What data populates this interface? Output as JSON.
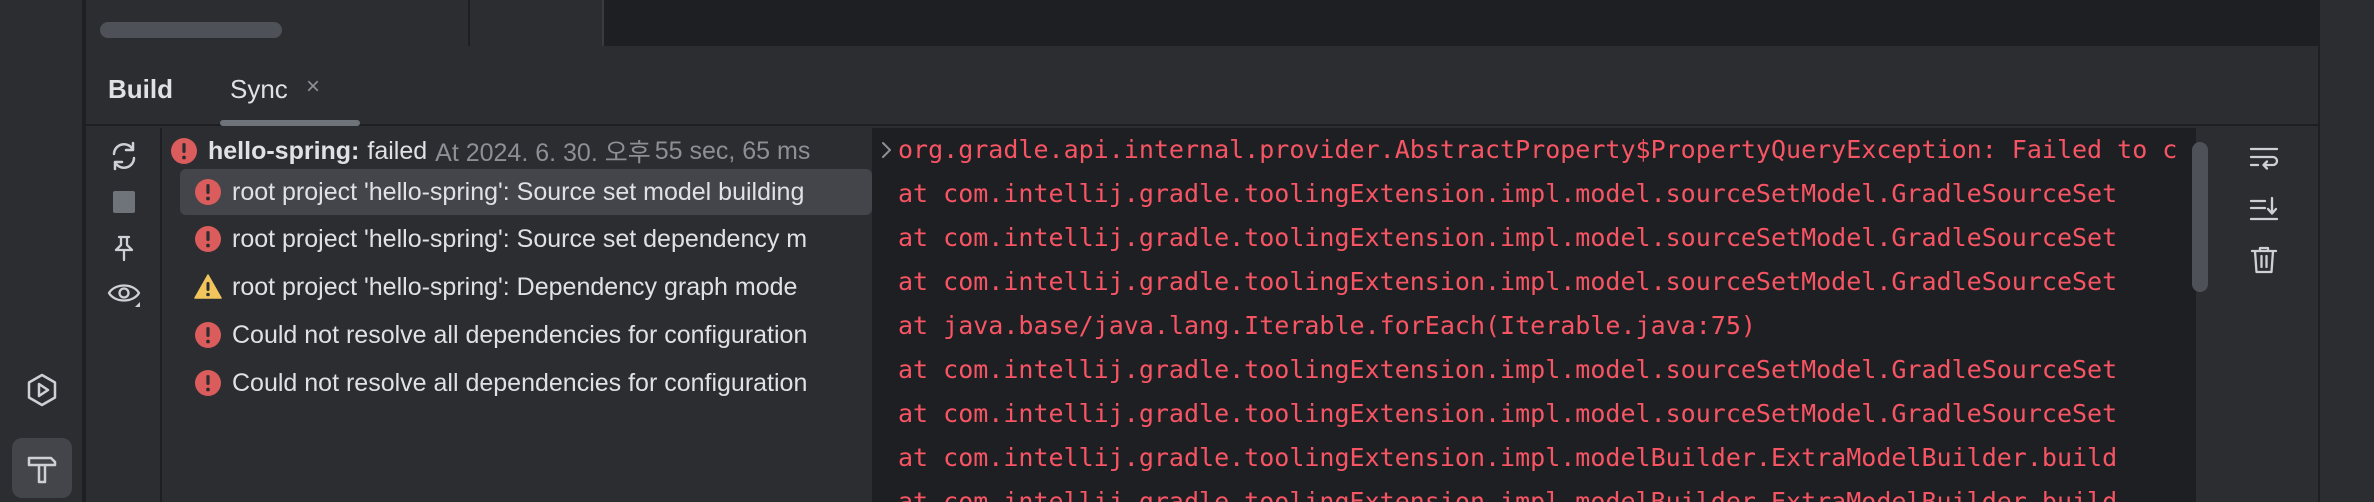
{
  "tool_window": {
    "title": "Build",
    "tabs": [
      {
        "label": "Sync",
        "close": "×"
      }
    ]
  },
  "toolbar": {
    "buttons": [
      "sync-icon",
      "stop-icon",
      "pin-icon",
      "eye-icon"
    ]
  },
  "tree": {
    "root": {
      "name": "hello-spring:",
      "status": "failed",
      "time": "At 2024. 6. 30. 오후",
      "duration": "55 sec, 65 ms"
    },
    "items": [
      {
        "icon": "error-icon",
        "text": "root project 'hello-spring': Source set model building"
      },
      {
        "icon": "error-icon",
        "text": "root project 'hello-spring': Source set dependency m"
      },
      {
        "icon": "warning-icon",
        "text": "root project 'hello-spring': Dependency graph mode"
      },
      {
        "icon": "error-icon",
        "text": "Could not resolve all dependencies for configuration"
      },
      {
        "icon": "error-icon",
        "text": "Could not resolve all dependencies for configuration"
      }
    ]
  },
  "console": {
    "lines": [
      "org.gradle.api.internal.provider.AbstractProperty$PropertyQueryException: Failed to c",
      "    at com.intellij.gradle.toolingExtension.impl.model.sourceSetModel.GradleSourceSet",
      "    at com.intellij.gradle.toolingExtension.impl.model.sourceSetModel.GradleSourceSet",
      "    at com.intellij.gradle.toolingExtension.impl.model.sourceSetModel.GradleSourceSet",
      "    at java.base/java.lang.Iterable.forEach(Iterable.java:75)",
      "    at com.intellij.gradle.toolingExtension.impl.model.sourceSetModel.GradleSourceSet",
      "    at com.intellij.gradle.toolingExtension.impl.model.sourceSetModel.GradleSourceSet",
      "    at com.intellij.gradle.toolingExtension.impl.modelBuilder.ExtraModelBuilder.build",
      "    at com.intellij.gradle.toolingExtension.impl.modelBuilder.ExtraModelBuilder.build"
    ]
  },
  "console_actions": [
    "soft-wrap-icon",
    "scroll-to-end-icon",
    "trash-icon"
  ],
  "left_strip": [
    "run-icon",
    "build-hammer-icon"
  ],
  "colors": {
    "background": "#2b2d30",
    "console_bg": "#1e1f22",
    "error_red": "#f75464",
    "warning_yellow": "#f2c55c",
    "text": "#dfe1e5",
    "muted": "#8c8f94",
    "selection": "#43454a"
  }
}
